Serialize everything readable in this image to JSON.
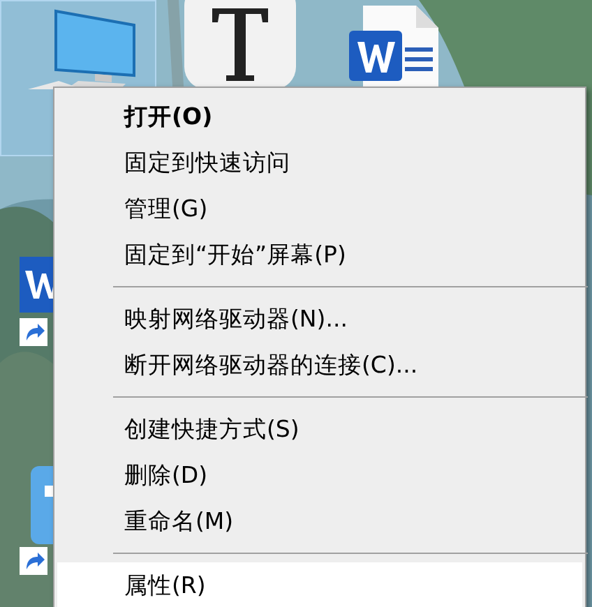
{
  "desktop": {
    "icons": [
      {
        "kind": "computer",
        "selected": true
      },
      {
        "kind": "typora"
      },
      {
        "kind": "word-doc"
      },
      {
        "kind": "word-shortcut"
      },
      {
        "kind": "app-shortcut"
      }
    ]
  },
  "context_menu": {
    "items": [
      {
        "kind": "item",
        "label": "打开(O)",
        "default": true,
        "selected": false
      },
      {
        "kind": "item",
        "label": "固定到快速访问",
        "default": false,
        "selected": false
      },
      {
        "kind": "item",
        "label": "管理(G)",
        "default": false,
        "selected": false
      },
      {
        "kind": "item",
        "label": "固定到“开始”屏幕(P)",
        "default": false,
        "selected": false
      },
      {
        "kind": "separator"
      },
      {
        "kind": "item",
        "label": "映射网络驱动器(N)...",
        "default": false,
        "selected": false
      },
      {
        "kind": "item",
        "label": "断开网络驱动器的连接(C)...",
        "default": false,
        "selected": false
      },
      {
        "kind": "separator"
      },
      {
        "kind": "item",
        "label": "创建快捷方式(S)",
        "default": false,
        "selected": false
      },
      {
        "kind": "item",
        "label": "删除(D)",
        "default": false,
        "selected": false
      },
      {
        "kind": "item",
        "label": "重命名(M)",
        "default": false,
        "selected": false
      },
      {
        "kind": "separator"
      },
      {
        "kind": "item",
        "label": "属性(R)",
        "default": false,
        "selected": true
      }
    ]
  }
}
